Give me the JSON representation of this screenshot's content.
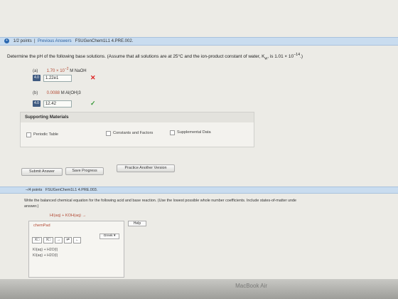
{
  "question1": {
    "header": {
      "points": "1/2 points",
      "previous_answers": "Previous Answers",
      "code": "FSUGenChem1L1 4.PRE.002."
    },
    "prompt": "Determine the pH of the following base solutions. (Assume that all solutions are at 25°C and the ion-product constant of water, K",
    "prompt_subscript": "w",
    "prompt_tail": ", is 1.01 × 10",
    "prompt_exp": "−14",
    "prompt_end": ".)",
    "parts": [
      {
        "label": "(a)",
        "quantity": "1.70 × 10",
        "exponent": "−2",
        "unit_species": "M NaOH",
        "tag": "4.0",
        "answer": "1.22e1",
        "status": "incorrect",
        "mark": "✕"
      },
      {
        "label": "(b)",
        "quantity": "0.0088",
        "exponent": "",
        "unit_species": "M Al(OH)3",
        "tag": "4.0",
        "answer": "12.42",
        "status": "correct",
        "mark": "✓"
      }
    ],
    "supporting": {
      "title": "Supporting Materials",
      "items": [
        "Periodic Table",
        "Constants and Factors",
        "Supplemental Data"
      ]
    },
    "buttons": {
      "submit": "Submit Answer",
      "save": "Save Progress",
      "practice": "Practice Another Version"
    }
  },
  "question2": {
    "number": "2.",
    "header": {
      "points": "–/4 points",
      "code": "FSUGenChem1L1 4.PRE.003."
    },
    "prompt_line1": "Write the balanced chemical equation for the following acid and base reaction. (Use the lowest possible whole number coefficients. Include states-of-matter unde",
    "prompt_line2": "answer.)",
    "reaction": "HI(aq) + KOH(aq) →",
    "chempad": {
      "title": "chemPad",
      "help": "Help",
      "greek": "Greek",
      "tools": [
        "X□",
        "X□",
        "→",
        "⇌",
        "←"
      ],
      "lines": [
        "KI(aq) + H2O(l)",
        "KI(aq) + H2O(l)"
      ]
    }
  },
  "device": {
    "brand": "MacBook Air"
  },
  "colors": {
    "header_bg": "#c9dcef",
    "link": "#2b5f9e",
    "incorrect": "#dd2222",
    "correct": "#3a9a3a",
    "accent_red": "#b34b35"
  }
}
